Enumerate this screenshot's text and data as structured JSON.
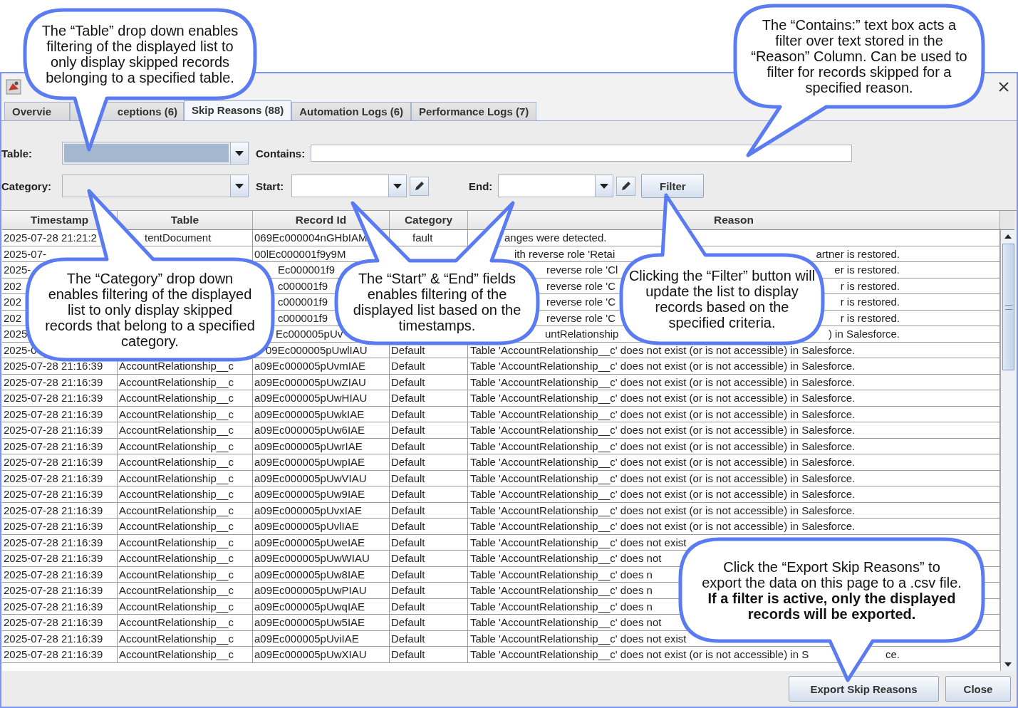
{
  "tabs": [
    {
      "label": "Overvie",
      "selected": false
    },
    {
      "label": "ceptions (6)",
      "selected": false
    },
    {
      "label": "Skip Reasons (88)",
      "selected": true
    },
    {
      "label": "Automation Logs (6)",
      "selected": false
    },
    {
      "label": "Performance Logs (7)",
      "selected": false
    }
  ],
  "filters": {
    "table": {
      "label": "Table:",
      "focused": true
    },
    "category": {
      "label": "Category:",
      "focused": false
    },
    "contains": {
      "label": "Contains:"
    },
    "start": {
      "label": "Start:"
    },
    "end": {
      "label": "End:"
    },
    "filter_button": "Filter"
  },
  "table": {
    "columns": [
      "Timestamp",
      "Table",
      "Record Id",
      "Category",
      "Reason"
    ],
    "rows": [
      {
        "timestamp": "2025-07-28 21:21:2",
        "table": "tentDocument",
        "record_id": "069Ec000004nGHbIAM",
        "category": "fault",
        "reason": "anges were detected."
      },
      {
        "timestamp": "2025-07-",
        "record_id": "00lEc000001f9y9M",
        "reason": "ith reverse role 'Retai",
        "reason_end": "artner is restored."
      },
      {
        "timestamp": "2025-",
        "record_id": "Ec000001f9",
        "reason": "reverse role 'Cl",
        "reason_end": "er is restored."
      },
      {
        "timestamp": "202",
        "record_id": "c000001f9",
        "reason": "reverse role 'C",
        "reason_end": "r is restored."
      },
      {
        "timestamp": "202",
        "record_id": "c000001f9",
        "reason": "reverse role 'C",
        "reason_end": "r is restored."
      },
      {
        "timestamp": "202",
        "record_id": "c000001f9",
        "reason": "reverse role 'C",
        "reason_end": "r is restored."
      },
      {
        "timestamp": "2025",
        "record_id": "Ec000005pUv",
        "reason": "untRelationship",
        "reason_end": ") in Salesforce."
      },
      {
        "timestamp": "2025-0",
        "record_id": "09Ec000005pUwlIAU",
        "category": "Default",
        "reason": "Table 'AccountRelationship__c' does not exist (or is not accessible) in Salesforce."
      },
      {
        "timestamp": "2025-07-28 21:16:39",
        "table": "AccountRelationship__c",
        "record_id": "a09Ec000005pUvmIAE",
        "category": "Default",
        "reason": "Table 'AccountRelationship__c' does not exist (or is not accessible) in Salesforce."
      },
      {
        "timestamp": "2025-07-28 21:16:39",
        "table": "AccountRelationship__c",
        "record_id": "a09Ec000005pUwZIAU",
        "category": "Default",
        "reason": "Table 'AccountRelationship__c' does not exist (or is not accessible) in Salesforce."
      },
      {
        "timestamp": "2025-07-28 21:16:39",
        "table": "AccountRelationship__c",
        "record_id": "a09Ec000005pUwHIAU",
        "category": "Default",
        "reason": "Table 'AccountRelationship__c' does not exist (or is not accessible) in Salesforce."
      },
      {
        "timestamp": "2025-07-28 21:16:39",
        "table": "AccountRelationship__c",
        "record_id": "a09Ec000005pUwkIAE",
        "category": "Default",
        "reason": "Table 'AccountRelationship__c' does not exist (or is not accessible) in Salesforce."
      },
      {
        "timestamp": "2025-07-28 21:16:39",
        "table": "AccountRelationship__c",
        "record_id": "a09Ec000005pUw6IAE",
        "category": "Default",
        "reason": "Table 'AccountRelationship__c' does not exist (or is not accessible) in Salesforce."
      },
      {
        "timestamp": "2025-07-28 21:16:39",
        "table": "AccountRelationship__c",
        "record_id": "a09Ec000005pUwrIAE",
        "category": "Default",
        "reason": "Table 'AccountRelationship__c' does not exist (or is not accessible) in Salesforce."
      },
      {
        "timestamp": "2025-07-28 21:16:39",
        "table": "AccountRelationship__c",
        "record_id": "a09Ec000005pUwpIAE",
        "category": "Default",
        "reason": "Table 'AccountRelationship__c' does not exist (or is not accessible) in Salesforce."
      },
      {
        "timestamp": "2025-07-28 21:16:39",
        "table": "AccountRelationship__c",
        "record_id": "a09Ec000005pUwVIAU",
        "category": "Default",
        "reason": "Table 'AccountRelationship__c' does not exist (or is not accessible) in Salesforce."
      },
      {
        "timestamp": "2025-07-28 21:16:39",
        "table": "AccountRelationship__c",
        "record_id": "a09Ec000005pUw9IAE",
        "category": "Default",
        "reason": "Table 'AccountRelationship__c' does not exist (or is not accessible) in Salesforce."
      },
      {
        "timestamp": "2025-07-28 21:16:39",
        "table": "AccountRelationship__c",
        "record_id": "a09Ec000005pUvxIAE",
        "category": "Default",
        "reason": "Table 'AccountRelationship__c' does not exist (or is not accessible) in Salesforce."
      },
      {
        "timestamp": "2025-07-28 21:16:39",
        "table": "AccountRelationship__c",
        "record_id": "a09Ec000005pUvlIAE",
        "category": "Default",
        "reason": "Table 'AccountRelationship__c' does not exist (or is not accessible) in Salesforce."
      },
      {
        "timestamp": "2025-07-28 21:16:39",
        "table": "AccountRelationship__c",
        "record_id": "a09Ec000005pUweIAE",
        "category": "Default",
        "reason": "Table 'AccountRelationship__c' does not exist"
      },
      {
        "timestamp": "2025-07-28 21:16:39",
        "table": "AccountRelationship__c",
        "record_id": "a09Ec000005pUwWIAU",
        "category": "Default",
        "reason": "Table 'AccountRelationship__c' does not"
      },
      {
        "timestamp": "2025-07-28 21:16:39",
        "table": "AccountRelationship__c",
        "record_id": "a09Ec000005pUw8IAE",
        "category": "Default",
        "reason": "Table 'AccountRelationship__c' does n"
      },
      {
        "timestamp": "2025-07-28 21:16:39",
        "table": "AccountRelationship__c",
        "record_id": "a09Ec000005pUwPIAU",
        "category": "Default",
        "reason": "Table 'AccountRelationship__c' does n"
      },
      {
        "timestamp": "2025-07-28 21:16:39",
        "table": "AccountRelationship__c",
        "record_id": "a09Ec000005pUwqIAE",
        "category": "Default",
        "reason": "Table 'AccountRelationship__c' does n"
      },
      {
        "timestamp": "2025-07-28 21:16:39",
        "table": "AccountRelationship__c",
        "record_id": "a09Ec000005pUw5IAE",
        "category": "Default",
        "reason": "Table 'AccountRelationship__c' does not"
      },
      {
        "timestamp": "2025-07-28 21:16:39",
        "table": "AccountRelationship__c",
        "record_id": "a09Ec000005pUviIAE",
        "category": "Default",
        "reason": "Table 'AccountRelationship__c' does not exist"
      },
      {
        "timestamp": "2025-07-28 21:16:39",
        "table": "AccountRelationship__c",
        "record_id": "a09Ec000005pUwXIAU",
        "category": "Default",
        "reason": "Table 'AccountRelationship__c' does not exist (or is not accessible) in S",
        "reason_end": "ce."
      }
    ]
  },
  "buttons": [
    "Export Skip Reasons",
    "Close"
  ],
  "callouts": [
    {
      "text": "The “Table” drop down enables filtering of the displayed list to only display skipped records belonging to a specified table."
    },
    {
      "text": "The “Contains:” text box acts a filter over text stored in the “Reason” Column. Can be used to filter for records skipped for a specified reason."
    },
    {
      "text": "The “Category” drop down enables filtering of the displayed list to only display skipped records that belong to a specified category."
    },
    {
      "text": "The “Start” & “End” fields enables filtering of the displayed list based on the timestamps."
    },
    {
      "text": "Clicking the “Filter” button will update the list to display records based on the specified criteria."
    },
    {
      "text": "Click the “Export Skip Reasons” to export the data on this page to a .csv file. **If a filter is active, only the displayed records will be exported.**"
    }
  ]
}
